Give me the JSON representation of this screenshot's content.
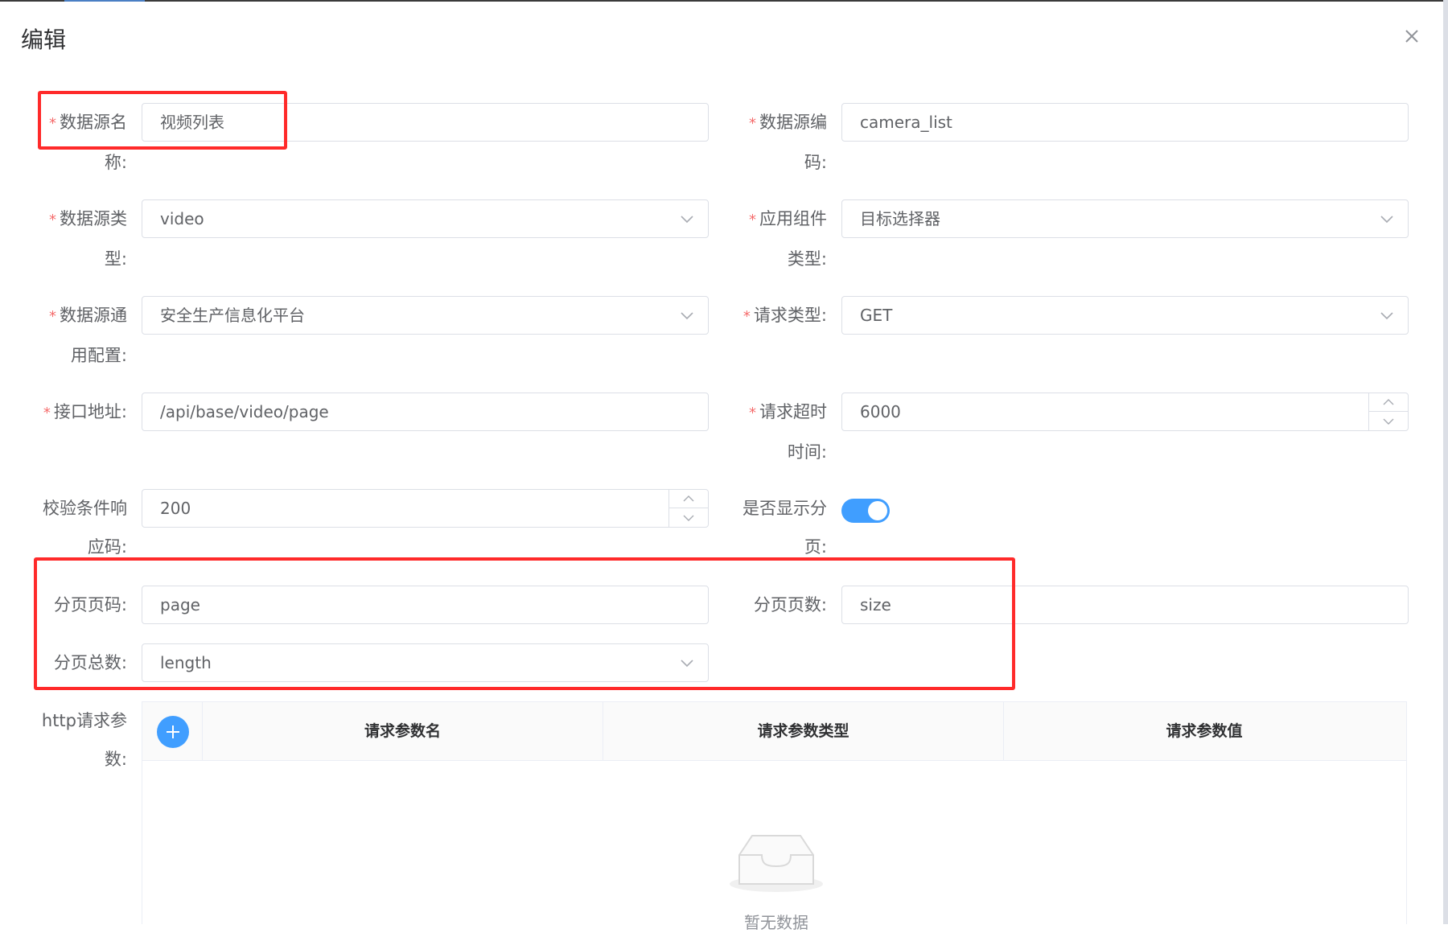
{
  "dialog": {
    "title": "编辑",
    "close_icon": "close-icon"
  },
  "form": {
    "required_mark": "*",
    "name": {
      "label_l1": "数据源名",
      "label_l2": "称:",
      "value": "视频列表"
    },
    "code": {
      "label_l1": "数据源编",
      "label_l2": "码:",
      "value": "camera_list"
    },
    "type": {
      "label_l1": "数据源类",
      "label_l2": "型:",
      "value": "video"
    },
    "component_type": {
      "label_l1": "应用组件",
      "label_l2": "类型:",
      "value": "目标选择器"
    },
    "general_config": {
      "label_l1": "数据源通",
      "label_l2": "用配置:",
      "value": "安全生产信息化平台"
    },
    "request_type": {
      "label_l1": "请求类型:",
      "value": "GET"
    },
    "api_url": {
      "label_l1": "接口地址:",
      "value": "/api/base/video/page"
    },
    "timeout": {
      "label_l1": "请求超时",
      "label_l2": "时间:",
      "value": "6000"
    },
    "check_code": {
      "label_l1": "校验条件响",
      "label_l2": "应码:",
      "value": "200"
    },
    "show_pagination": {
      "label_l1": "是否显示分",
      "label_l2": "页:",
      "on": true
    },
    "page_no": {
      "label_l1": "分页页码:",
      "value": "page"
    },
    "page_size": {
      "label_l1": "分页页数:",
      "value": "size"
    },
    "page_total": {
      "label_l1": "分页总数:",
      "value": "length"
    },
    "http_params": {
      "label_l1": "http请求参",
      "label_l2": "数:"
    }
  },
  "params_table": {
    "columns": [
      "请求参数名",
      "请求参数类型",
      "请求参数值"
    ],
    "empty_text": "暂无数据"
  },
  "colors": {
    "primary": "#409eff",
    "required": "#f56c6c",
    "highlight_box": "#ff2a2a"
  }
}
